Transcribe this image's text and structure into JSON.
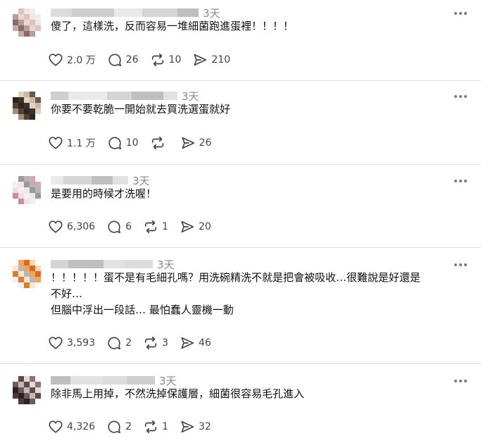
{
  "comments": [
    {
      "time": "3天",
      "text_lines": [
        "傻了，這樣洗，反而容易一堆細菌跑進蛋裡！！！！"
      ],
      "likes": "2.0 万",
      "replies": "26",
      "reposts": "10",
      "shares": "210",
      "avatar_colors": [
        "#e8d7d2",
        "#c9a9a6",
        "#f1e6e3",
        "#b89f9c",
        "#2a2a2a",
        "#d9c3bf",
        "#8a6b68",
        "#f3ecea"
      ]
    },
    {
      "time": "3天",
      "text_lines": [
        "你要不要乾脆一開始就去買洗選蛋就好"
      ],
      "likes": "1.1 万",
      "replies": "10",
      "reposts": "",
      "shares": "26",
      "avatar_colors": [
        "#6b5a4a",
        "#3d3228",
        "#a58c72",
        "#cdb9a3",
        "#2d2620",
        "#8b7560",
        "#e0d3c2",
        "#4f4236"
      ]
    },
    {
      "time": "3天",
      "text_lines": [
        "是要用的時候才洗喔！"
      ],
      "likes": "6,306",
      "replies": "6",
      "reposts": "1",
      "shares": "20",
      "avatar_colors": [
        "#f2dfe3",
        "#d9a7b3",
        "#efe6e8",
        "#c98d9b",
        "#b5b5b5",
        "#f7eef0",
        "#e3c3cb",
        "#9a9a9a"
      ]
    },
    {
      "time": "3天",
      "text_lines": [
        "！！！！！蛋不是有毛細孔嗎？用洗碗精洗不就是把會被吸收…很難說是好還是",
        "不好…",
        "但腦中浮出一段話… 最怕蠢人靈機一動"
      ],
      "likes": "3,593",
      "replies": "2",
      "reposts": "3",
      "shares": "46",
      "avatar_colors": [
        "#f4a35a",
        "#e07a2a",
        "#f7d9b8",
        "#b8b8b8",
        "#f0f0f0",
        "#d96a1e",
        "#fbe7d2",
        "#8f8f8f"
      ]
    },
    {
      "time": "3天",
      "text_lines": [
        "除非馬上用掉，不然洗掉保護層，細菌很容易毛孔進入"
      ],
      "likes": "4,326",
      "replies": "2",
      "reposts": "1",
      "shares": "32",
      "avatar_colors": [
        "#3b3030",
        "#5a4a48",
        "#2a2222",
        "#8a7472",
        "#c8b7b5",
        "#4a3d3c",
        "#e2d8d7",
        "#6d5b59"
      ]
    }
  ]
}
